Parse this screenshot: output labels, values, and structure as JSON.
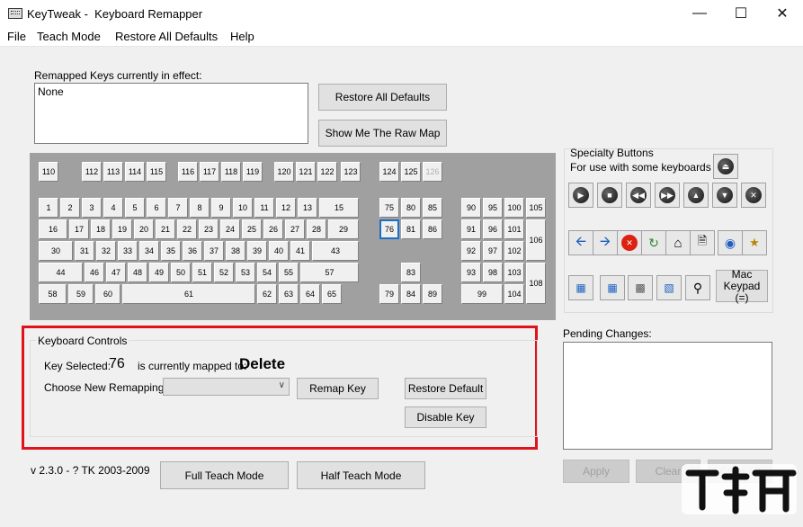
{
  "window": {
    "title": "KeyTweak -  Keyboard Remapper",
    "minimize": "—",
    "maximize": "☐",
    "close": "✕"
  },
  "menu": [
    "File",
    "Teach Mode",
    "Restore All Defaults",
    "Help"
  ],
  "remapped": {
    "label": "Remapped Keys currently in effect:",
    "value": "None"
  },
  "buttons": {
    "restore_all": "Restore All Defaults",
    "raw_map": "Show Me The Raw Map",
    "remap_key": "Remap Key",
    "restore_default": "Restore Default",
    "disable_key": "Disable Key",
    "full_teach": "Full Teach Mode",
    "half_teach": "Half Teach Mode",
    "apply": "Apply",
    "clear": "Clear",
    "clear_all": "Clear All"
  },
  "keyboard": {
    "fn_row": [
      "110",
      "112",
      "113",
      "114",
      "115",
      "116",
      "117",
      "118",
      "119",
      "120",
      "121",
      "122",
      "123",
      "124",
      "125",
      "126"
    ],
    "row1": [
      "1",
      "2",
      "3",
      "4",
      "5",
      "6",
      "7",
      "8",
      "9",
      "10",
      "11",
      "12",
      "13",
      "15"
    ],
    "row2": [
      "16",
      "17",
      "18",
      "19",
      "20",
      "21",
      "22",
      "23",
      "24",
      "25",
      "26",
      "27",
      "28",
      "29"
    ],
    "row3": [
      "30",
      "31",
      "32",
      "33",
      "34",
      "35",
      "36",
      "37",
      "38",
      "39",
      "40",
      "41",
      "43"
    ],
    "row4": [
      "44",
      "46",
      "47",
      "48",
      "49",
      "50",
      "51",
      "52",
      "53",
      "54",
      "55",
      "57"
    ],
    "row5": [
      "58",
      "59",
      "60",
      "61",
      "62",
      "63",
      "64",
      "65"
    ],
    "nav": [
      "75",
      "80",
      "85",
      "76",
      "81",
      "86",
      "83",
      "79",
      "84",
      "89"
    ],
    "numpad": [
      "90",
      "95",
      "100",
      "105",
      "91",
      "96",
      "101",
      "106",
      "92",
      "97",
      "102",
      "93",
      "98",
      "103",
      "108",
      "99",
      "104"
    ],
    "selected": "76"
  },
  "specialty": {
    "title": "Specialty Buttons",
    "subtitle": "For use with some keyboards",
    "mac_keypad": "Mac Keypad (=)"
  },
  "controls": {
    "group_label": "Keyboard Controls",
    "key_selected_label": "Key Selected:",
    "key_selected_value": "76",
    "mapped_label": "is currently mapped to:",
    "mapped_value": "Delete",
    "choose_label": "Choose New Remapping",
    "dropdown_value": ""
  },
  "pending": {
    "label": "Pending Changes:"
  },
  "version": "v 2.3.0 - ? TK 2003-2009",
  "colors": {
    "highlight_box": "#e0121b",
    "selected_key_border": "#1a6fc7"
  }
}
